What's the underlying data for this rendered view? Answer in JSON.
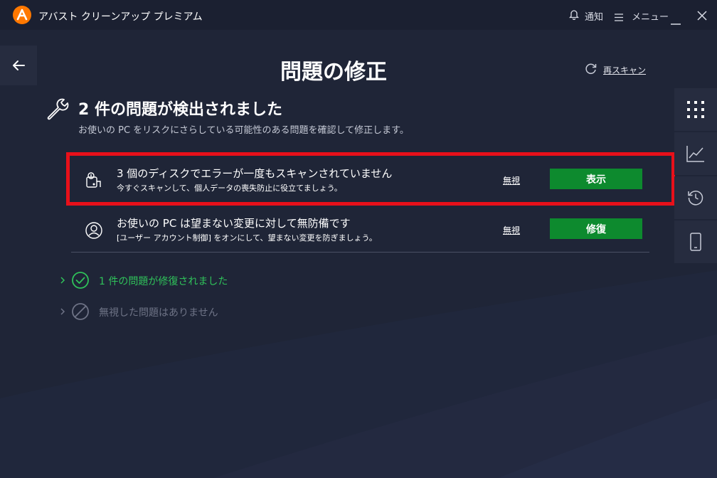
{
  "app": {
    "title": "アバスト クリーンアップ プレミアム"
  },
  "titlebar": {
    "notifications_label": "通知",
    "menu_label": "メニュー"
  },
  "page": {
    "title": "問題の修正",
    "rescan_label": "再スキャン",
    "heading": "2 件の問題が検出されました",
    "subheading": "お使いの PC をリスクにさらしている可能性のある問題を確認して修正します。"
  },
  "issues": [
    {
      "title": "3 個のディスクでエラーが一度もスキャンされていません",
      "description": "今すぐスキャンして、個人データの喪失防止に役立てましょう。",
      "ignore_label": "無視",
      "action_label": "表示",
      "icon": "disk-scan-icon"
    },
    {
      "title": "お使いの PC は望まない変更に対して無防備です",
      "description": "[ユーザー アカウント制御] をオンにして、望まない変更を防ぎましょう。",
      "ignore_label": "無視",
      "action_label": "修復",
      "icon": "user-shield-icon"
    }
  ],
  "summary": {
    "fixed_label": "1 件の問題が修復されました",
    "ignored_label": "無視した問題はありません"
  },
  "colors": {
    "background": "#1f2537",
    "accent_orange": "#ff7800",
    "button_green": "#0d8a2e",
    "fixed_green": "#2fc25a",
    "highlight_red": "#e8101a"
  },
  "sidebar_icons": [
    "apps-grid-icon",
    "chart-icon",
    "history-icon",
    "mobile-icon"
  ]
}
